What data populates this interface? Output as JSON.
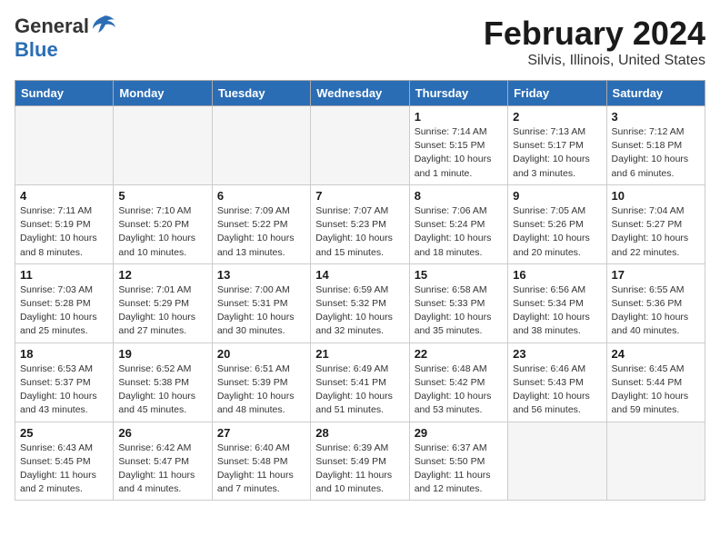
{
  "header": {
    "logo_general": "General",
    "logo_blue": "Blue",
    "title": "February 2024",
    "subtitle": "Silvis, Illinois, United States"
  },
  "weekdays": [
    "Sunday",
    "Monday",
    "Tuesday",
    "Wednesday",
    "Thursday",
    "Friday",
    "Saturday"
  ],
  "weeks": [
    [
      {
        "day": "",
        "empty": true
      },
      {
        "day": "",
        "empty": true
      },
      {
        "day": "",
        "empty": true
      },
      {
        "day": "",
        "empty": true
      },
      {
        "day": "1",
        "sunrise": "Sunrise: 7:14 AM",
        "sunset": "Sunset: 5:15 PM",
        "daylight": "Daylight: 10 hours and 1 minute."
      },
      {
        "day": "2",
        "sunrise": "Sunrise: 7:13 AM",
        "sunset": "Sunset: 5:17 PM",
        "daylight": "Daylight: 10 hours and 3 minutes."
      },
      {
        "day": "3",
        "sunrise": "Sunrise: 7:12 AM",
        "sunset": "Sunset: 5:18 PM",
        "daylight": "Daylight: 10 hours and 6 minutes."
      }
    ],
    [
      {
        "day": "4",
        "sunrise": "Sunrise: 7:11 AM",
        "sunset": "Sunset: 5:19 PM",
        "daylight": "Daylight: 10 hours and 8 minutes."
      },
      {
        "day": "5",
        "sunrise": "Sunrise: 7:10 AM",
        "sunset": "Sunset: 5:20 PM",
        "daylight": "Daylight: 10 hours and 10 minutes."
      },
      {
        "day": "6",
        "sunrise": "Sunrise: 7:09 AM",
        "sunset": "Sunset: 5:22 PM",
        "daylight": "Daylight: 10 hours and 13 minutes."
      },
      {
        "day": "7",
        "sunrise": "Sunrise: 7:07 AM",
        "sunset": "Sunset: 5:23 PM",
        "daylight": "Daylight: 10 hours and 15 minutes."
      },
      {
        "day": "8",
        "sunrise": "Sunrise: 7:06 AM",
        "sunset": "Sunset: 5:24 PM",
        "daylight": "Daylight: 10 hours and 18 minutes."
      },
      {
        "day": "9",
        "sunrise": "Sunrise: 7:05 AM",
        "sunset": "Sunset: 5:26 PM",
        "daylight": "Daylight: 10 hours and 20 minutes."
      },
      {
        "day": "10",
        "sunrise": "Sunrise: 7:04 AM",
        "sunset": "Sunset: 5:27 PM",
        "daylight": "Daylight: 10 hours and 22 minutes."
      }
    ],
    [
      {
        "day": "11",
        "sunrise": "Sunrise: 7:03 AM",
        "sunset": "Sunset: 5:28 PM",
        "daylight": "Daylight: 10 hours and 25 minutes."
      },
      {
        "day": "12",
        "sunrise": "Sunrise: 7:01 AM",
        "sunset": "Sunset: 5:29 PM",
        "daylight": "Daylight: 10 hours and 27 minutes."
      },
      {
        "day": "13",
        "sunrise": "Sunrise: 7:00 AM",
        "sunset": "Sunset: 5:31 PM",
        "daylight": "Daylight: 10 hours and 30 minutes."
      },
      {
        "day": "14",
        "sunrise": "Sunrise: 6:59 AM",
        "sunset": "Sunset: 5:32 PM",
        "daylight": "Daylight: 10 hours and 32 minutes."
      },
      {
        "day": "15",
        "sunrise": "Sunrise: 6:58 AM",
        "sunset": "Sunset: 5:33 PM",
        "daylight": "Daylight: 10 hours and 35 minutes."
      },
      {
        "day": "16",
        "sunrise": "Sunrise: 6:56 AM",
        "sunset": "Sunset: 5:34 PM",
        "daylight": "Daylight: 10 hours and 38 minutes."
      },
      {
        "day": "17",
        "sunrise": "Sunrise: 6:55 AM",
        "sunset": "Sunset: 5:36 PM",
        "daylight": "Daylight: 10 hours and 40 minutes."
      }
    ],
    [
      {
        "day": "18",
        "sunrise": "Sunrise: 6:53 AM",
        "sunset": "Sunset: 5:37 PM",
        "daylight": "Daylight: 10 hours and 43 minutes."
      },
      {
        "day": "19",
        "sunrise": "Sunrise: 6:52 AM",
        "sunset": "Sunset: 5:38 PM",
        "daylight": "Daylight: 10 hours and 45 minutes."
      },
      {
        "day": "20",
        "sunrise": "Sunrise: 6:51 AM",
        "sunset": "Sunset: 5:39 PM",
        "daylight": "Daylight: 10 hours and 48 minutes."
      },
      {
        "day": "21",
        "sunrise": "Sunrise: 6:49 AM",
        "sunset": "Sunset: 5:41 PM",
        "daylight": "Daylight: 10 hours and 51 minutes."
      },
      {
        "day": "22",
        "sunrise": "Sunrise: 6:48 AM",
        "sunset": "Sunset: 5:42 PM",
        "daylight": "Daylight: 10 hours and 53 minutes."
      },
      {
        "day": "23",
        "sunrise": "Sunrise: 6:46 AM",
        "sunset": "Sunset: 5:43 PM",
        "daylight": "Daylight: 10 hours and 56 minutes."
      },
      {
        "day": "24",
        "sunrise": "Sunrise: 6:45 AM",
        "sunset": "Sunset: 5:44 PM",
        "daylight": "Daylight: 10 hours and 59 minutes."
      }
    ],
    [
      {
        "day": "25",
        "sunrise": "Sunrise: 6:43 AM",
        "sunset": "Sunset: 5:45 PM",
        "daylight": "Daylight: 11 hours and 2 minutes."
      },
      {
        "day": "26",
        "sunrise": "Sunrise: 6:42 AM",
        "sunset": "Sunset: 5:47 PM",
        "daylight": "Daylight: 11 hours and 4 minutes."
      },
      {
        "day": "27",
        "sunrise": "Sunrise: 6:40 AM",
        "sunset": "Sunset: 5:48 PM",
        "daylight": "Daylight: 11 hours and 7 minutes."
      },
      {
        "day": "28",
        "sunrise": "Sunrise: 6:39 AM",
        "sunset": "Sunset: 5:49 PM",
        "daylight": "Daylight: 11 hours and 10 minutes."
      },
      {
        "day": "29",
        "sunrise": "Sunrise: 6:37 AM",
        "sunset": "Sunset: 5:50 PM",
        "daylight": "Daylight: 11 hours and 12 minutes."
      },
      {
        "day": "",
        "empty": true
      },
      {
        "day": "",
        "empty": true
      }
    ]
  ]
}
